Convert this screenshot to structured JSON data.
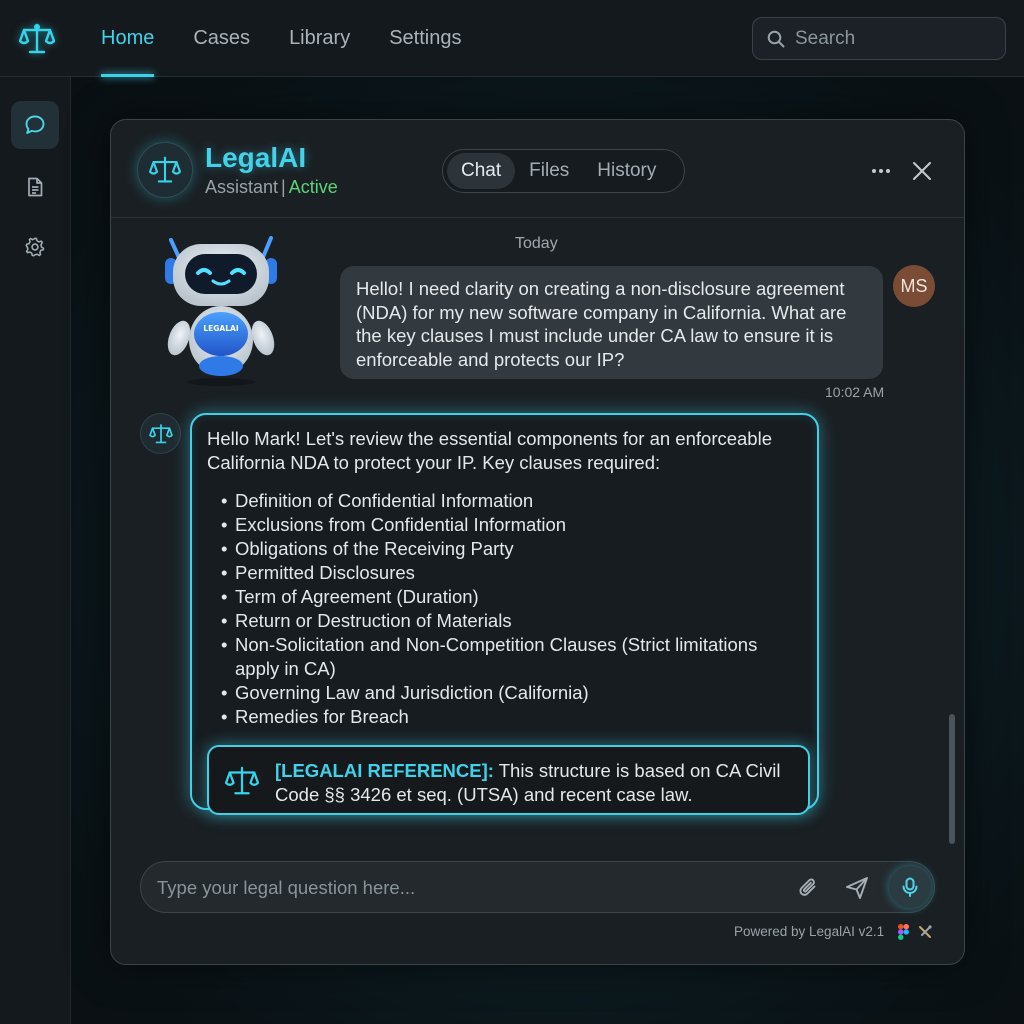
{
  "app": {
    "logo_icon": "scales-of-justice-icon",
    "accent": "#3fd2ea"
  },
  "nav": {
    "items": [
      {
        "label": "Home",
        "active": true
      },
      {
        "label": "Cases",
        "active": false
      },
      {
        "label": "Library",
        "active": false
      },
      {
        "label": "Settings",
        "active": false
      }
    ]
  },
  "search": {
    "placeholder": "Search",
    "value": ""
  },
  "rail": {
    "items": [
      {
        "icon": "chat-bubble-icon",
        "active": true
      },
      {
        "icon": "document-icon",
        "active": false
      },
      {
        "icon": "gear-icon",
        "active": false
      }
    ]
  },
  "chat": {
    "brand_name": "LegalAI",
    "subtitle_role": "Assistant",
    "subtitle_separator": "|",
    "subtitle_status": "Active",
    "status_color": "#5fd37a",
    "tabs": [
      {
        "label": "Chat",
        "active": true
      },
      {
        "label": "Files",
        "active": false
      },
      {
        "label": "History",
        "active": false
      }
    ],
    "day_label": "Today",
    "robot_badge": "LEGALAI",
    "user_initials": "MS",
    "user_message": "Hello! I need clarity on creating a non-disclosure agreement (NDA) for my new software company in California. What are the key clauses I must include under CA law to ensure it is enforceable and protects our IP?",
    "user_time": "10:02 AM",
    "bot_intro": "Hello Mark! Let's review the essential components for an enforceable California NDA to protect your IP. Key clauses required:",
    "bot_list": [
      "Definition of Confidential Information",
      "Exclusions from Confidential Information",
      "Obligations of the Receiving Party",
      "Permitted Disclosures",
      "Term of Agreement (Duration)",
      "Return or Destruction of Materials",
      "Non-Solicitation and Non-Competition Clauses (Strict limitations apply in CA)",
      "Governing Law and Jurisdiction (California)",
      "Remedies for Breach"
    ],
    "reference_tag": "[LEGALAI REFERENCE]:",
    "reference_text": " This structure is based on CA Civil Code §§ 3426 et seq. (UTSA) and recent case law.",
    "composer_placeholder": "Type your legal question here...",
    "composer_value": "",
    "powered_by": "Powered by LegalAI v2.1"
  }
}
